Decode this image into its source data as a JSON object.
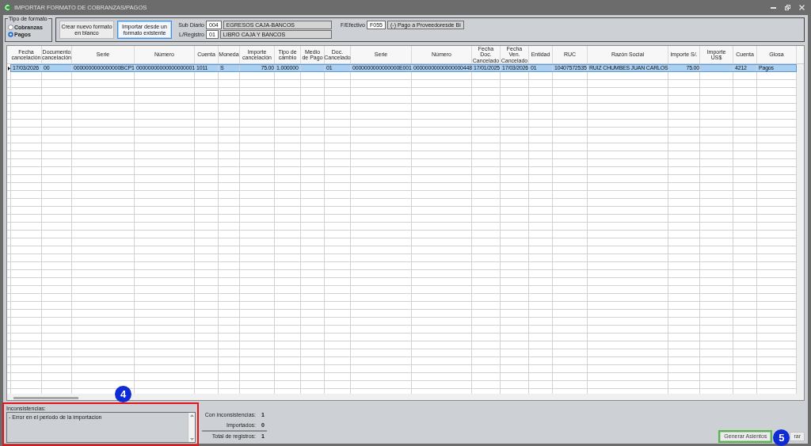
{
  "window": {
    "title": "IMPORTAR FORMATO DE COBRANZAS/PAGOS"
  },
  "format_type": {
    "title": "Tipo de formato",
    "options": [
      {
        "label": "Cobranzas",
        "selected": false
      },
      {
        "label": "Pagos",
        "selected": true
      }
    ]
  },
  "format_buttons": [
    {
      "label": "Crear nuevo formato en blanco",
      "focused": false
    },
    {
      "label": "Importar desde un formato existente",
      "focused": true
    }
  ],
  "fields": [
    {
      "label": "Sub Diario",
      "code": "004",
      "description": "EGRESOS CAJA-BANCOS"
    },
    {
      "label": "L/Registro",
      "code": "01",
      "description": "LIBRO CAJA Y BANCOS"
    },
    {
      "label": "F/Efectivo",
      "code": "F055",
      "description": "(-) Pago a Proveedoresde Bi"
    }
  ],
  "table": {
    "columns": [
      "Fecha cancelación",
      "Documento cancelación",
      "Serie",
      "Número",
      "Cuenta",
      "Moneda",
      "Importe cancelación",
      "Tipo de cambio",
      "Medio de Pago",
      "Doc. Cancelado",
      "Serie",
      "Número",
      "Fecha Doc. Cancelado",
      "Fecha Ven. Cancelado",
      "Entidad",
      "RUC",
      "Razón Social",
      "Importe S/.",
      "Importe US$",
      "Cuenta",
      "Glosa"
    ],
    "rows": [
      {
        "selected": true,
        "cells": [
          "17/03/2026",
          "00",
          "0000000000000000BCP1",
          "00000000000000000001",
          "1011",
          "S",
          "75.00",
          "1.000000",
          null,
          "01",
          "0000000000000000E001",
          "00000000000000000448",
          "17/01/2025",
          "17/03/2026",
          "01",
          "10407572535",
          "RUIZ CHUMBES JUAN CARLOS",
          "75.00",
          null,
          "4212",
          "Pagos"
        ]
      }
    ]
  },
  "inconsistencies": {
    "label": "Inconsistencias:",
    "messages": [
      "- Error en el periodo de la importacion"
    ],
    "callout": {
      "number": "4",
      "color": "#e3151b"
    }
  },
  "summary": [
    {
      "label": "Con inconsistencias:",
      "value": "1"
    },
    {
      "label": "Importados:",
      "value": "0"
    },
    {
      "label": "Total de registros:",
      "value": "1"
    }
  ],
  "actions": [
    {
      "label": "Generar Asientos",
      "callout": {
        "number": "5",
        "color": "#52b947"
      }
    },
    {
      "label": "rar"
    }
  ]
}
